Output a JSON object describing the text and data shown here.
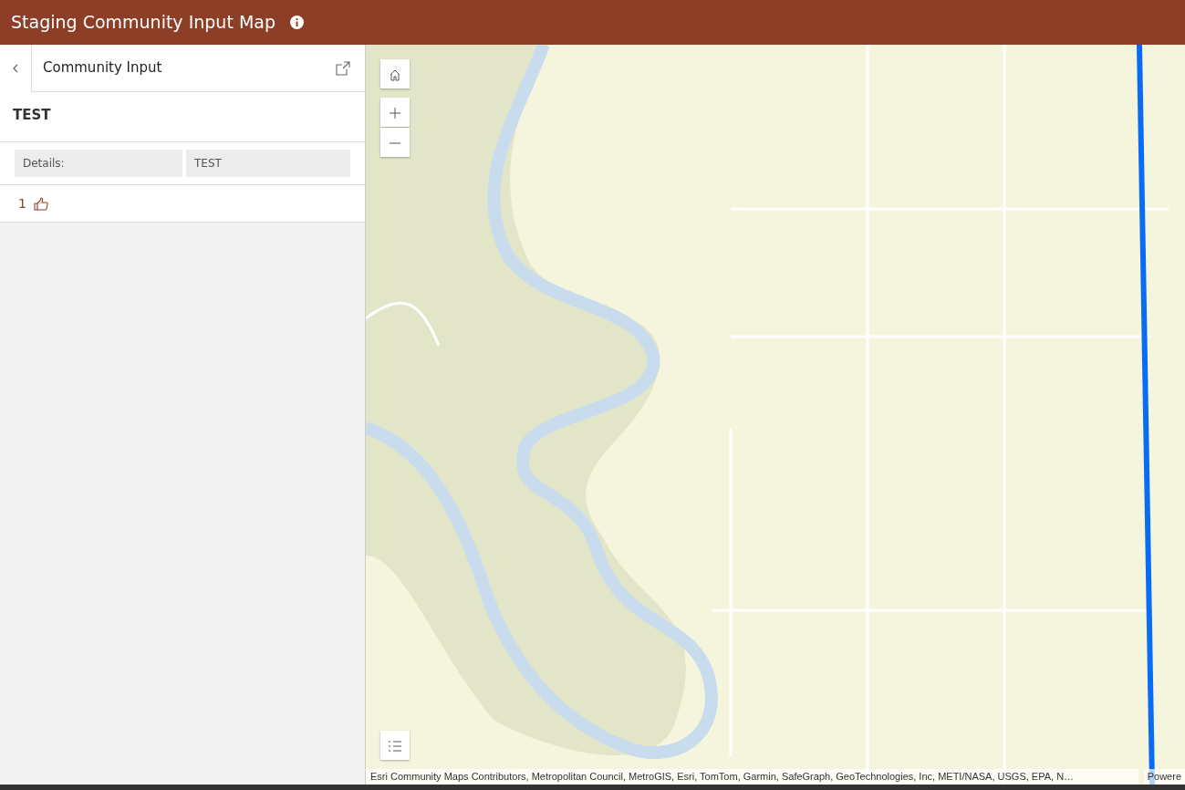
{
  "header": {
    "title": "Staging Community Input Map"
  },
  "panel": {
    "title": "Community Input",
    "feature_title": "TEST",
    "fields": [
      {
        "label": "Details:",
        "value": "TEST"
      }
    ],
    "likes": "1"
  },
  "map": {
    "attribution": "Esri Community Maps Contributors, Metropolitan Council, MetroGIS, Esri, TomTom, Garmin, SafeGraph, GeoTechnologies, Inc, METI/NASA, USGS, EPA, N…",
    "powered_by": "Powere"
  }
}
